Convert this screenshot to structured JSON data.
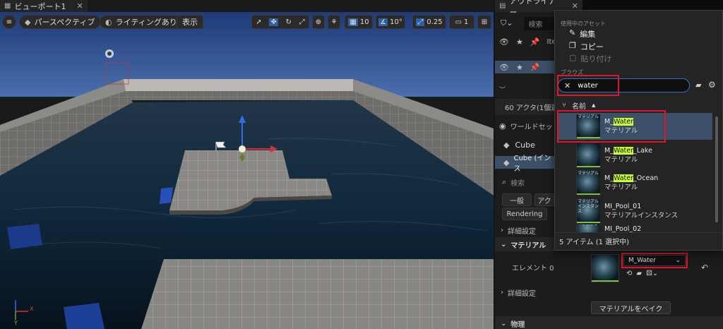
{
  "viewport": {
    "tab_title": "ビューポート1",
    "perspective_label": "パースペクティブ",
    "lighting_label": "ライティングあり",
    "show_label": "表示",
    "grid_snap": "10",
    "angle_snap": "10°",
    "scale_snap": "0.25",
    "camera_speed": "1",
    "axis_x": "X",
    "axis_y": "Y"
  },
  "outliner": {
    "tab_title": "アウトライナー",
    "search_placeholder": "検索",
    "row1_label": "Item",
    "actor_count": "60 アクタ(1個選",
    "world_settings": "ワールドセッ"
  },
  "details": {
    "actor_name": "Cube",
    "component": "Cube (インス",
    "search_placeholder": "検索",
    "filter_general": "一般",
    "filter_actor": "アク",
    "filter_rendering": "Rendering",
    "section_advanced": "詳細設定",
    "section_material": "マテリアル",
    "element_label": "エレメント 0",
    "material_value": "M_Water",
    "section_advanced2": "詳細設定",
    "bake_button": "マテリアルをベイク",
    "section_physics": "物理"
  },
  "picker": {
    "current_asset_header": "使用中のアセット",
    "edit": "編集",
    "copy": "コピー",
    "paste": "貼り付け",
    "browse_header": "ブラウズ",
    "search_value": "water",
    "column_name": "名前",
    "items": [
      {
        "name_pre": "M_",
        "name_hl": "Water",
        "name_post": "",
        "type": "マテリアル",
        "thumb_label": "マテリアル",
        "selected": true
      },
      {
        "name_pre": "M_",
        "name_hl": "Water",
        "name_post": "_Lake",
        "type": "マテリアル",
        "thumb_label": "",
        "selected": false
      },
      {
        "name_pre": "M_",
        "name_hl": "Water",
        "name_post": "_Ocean",
        "type": "マテリアル",
        "thumb_label": "マテリアル",
        "selected": false
      },
      {
        "name_pre": "MI_Pool_01",
        "name_hl": "",
        "name_post": "",
        "type": "マテリアルインスタンス",
        "thumb_label": "マテリアル インスタン ス",
        "selected": false
      },
      {
        "name_pre": "MI_Pool_02",
        "name_hl": "",
        "name_post": "",
        "type": "",
        "thumb_label": "マテリアル インスタン",
        "selected": false
      }
    ],
    "footer": "5 アイテム (1 選択中)"
  },
  "colors": {
    "accent_highlight": "#c9ff2e",
    "annotation_red": "#e0142a",
    "selection_blue": "#3b4f66"
  }
}
